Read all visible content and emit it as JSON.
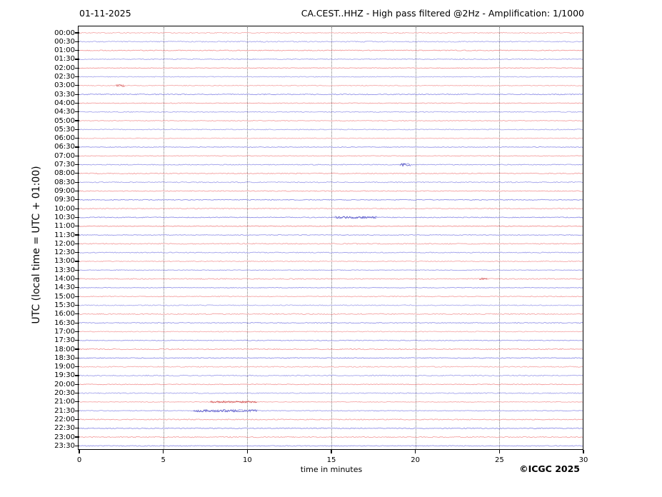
{
  "page": {
    "background": "#ffffff"
  },
  "header": {
    "date": "01-11-2025",
    "title": "CA.CEST..HHZ - High pass filtered @2Hz - Amplification: 1/1000"
  },
  "footer": {
    "attribution": "©ICGC 2025"
  },
  "chart_data": {
    "type": "line",
    "subtype": "helicorder-day-plot",
    "title": "CA.CEST..HHZ - High pass filtered @2Hz - Amplification: 1/1000",
    "date": "01-11-2025",
    "station": "CA.CEST..HHZ",
    "processing": "High pass filtered @2Hz",
    "amplification": "1/1000",
    "xlabel": "time in minutes",
    "ylabel": "UTC (local time = UTC + 01:00)",
    "xlim": [
      0,
      30
    ],
    "xticks": [
      0,
      5,
      10,
      15,
      20,
      25,
      30
    ],
    "grid": "vertical dotted lines at 5-minute intervals",
    "row_interval_minutes": 30,
    "trace_colors": {
      "red": "#f28f8f",
      "blue": "#8a8ae6"
    },
    "event_colors": {
      "red": "#c43838",
      "blue": "#4343bb"
    },
    "rows": [
      {
        "label": "00:00",
        "color": "red"
      },
      {
        "label": "00:30",
        "color": "blue"
      },
      {
        "label": "01:00",
        "color": "red"
      },
      {
        "label": "01:30",
        "color": "blue"
      },
      {
        "label": "02:00",
        "color": "red"
      },
      {
        "label": "02:30",
        "color": "blue"
      },
      {
        "label": "03:00",
        "color": "red",
        "events": [
          {
            "start_min": 2.2,
            "end_min": 2.7,
            "amplitude": 1.6
          }
        ]
      },
      {
        "label": "03:30",
        "color": "blue"
      },
      {
        "label": "04:00",
        "color": "red"
      },
      {
        "label": "04:30",
        "color": "blue"
      },
      {
        "label": "05:00",
        "color": "red"
      },
      {
        "label": "05:30",
        "color": "blue"
      },
      {
        "label": "06:00",
        "color": "red"
      },
      {
        "label": "06:30",
        "color": "blue"
      },
      {
        "label": "07:00",
        "color": "red"
      },
      {
        "label": "07:30",
        "color": "blue",
        "events": [
          {
            "start_min": 19.1,
            "end_min": 19.7,
            "amplitude": 2.2
          }
        ]
      },
      {
        "label": "08:00",
        "color": "red"
      },
      {
        "label": "08:30",
        "color": "blue"
      },
      {
        "label": "09:00",
        "color": "red"
      },
      {
        "label": "09:30",
        "color": "blue"
      },
      {
        "label": "10:00",
        "color": "red"
      },
      {
        "label": "10:30",
        "color": "blue",
        "events": [
          {
            "start_min": 15.2,
            "end_min": 17.7,
            "amplitude": 1.6
          }
        ]
      },
      {
        "label": "11:00",
        "color": "red"
      },
      {
        "label": "11:30",
        "color": "blue"
      },
      {
        "label": "12:00",
        "color": "red"
      },
      {
        "label": "12:30",
        "color": "blue"
      },
      {
        "label": "13:00",
        "color": "red"
      },
      {
        "label": "13:30",
        "color": "blue"
      },
      {
        "label": "14:00",
        "color": "red",
        "events": [
          {
            "start_min": 23.8,
            "end_min": 24.3,
            "amplitude": 1.4
          }
        ]
      },
      {
        "label": "14:30",
        "color": "blue"
      },
      {
        "label": "15:00",
        "color": "red"
      },
      {
        "label": "15:30",
        "color": "blue"
      },
      {
        "label": "16:00",
        "color": "red"
      },
      {
        "label": "16:30",
        "color": "blue"
      },
      {
        "label": "17:00",
        "color": "red"
      },
      {
        "label": "17:30",
        "color": "blue"
      },
      {
        "label": "18:00",
        "color": "red"
      },
      {
        "label": "18:30",
        "color": "blue"
      },
      {
        "label": "19:00",
        "color": "red"
      },
      {
        "label": "19:30",
        "color": "blue"
      },
      {
        "label": "20:00",
        "color": "red"
      },
      {
        "label": "20:30",
        "color": "blue"
      },
      {
        "label": "21:00",
        "color": "red",
        "events": [
          {
            "start_min": 7.8,
            "end_min": 10.6,
            "amplitude": 1.4
          }
        ]
      },
      {
        "label": "21:30",
        "color": "blue",
        "events": [
          {
            "start_min": 6.8,
            "end_min": 10.6,
            "amplitude": 1.9
          }
        ]
      },
      {
        "label": "22:00",
        "color": "red"
      },
      {
        "label": "22:30",
        "color": "blue"
      },
      {
        "label": "23:00",
        "color": "red"
      },
      {
        "label": "23:30",
        "color": "blue"
      }
    ]
  }
}
